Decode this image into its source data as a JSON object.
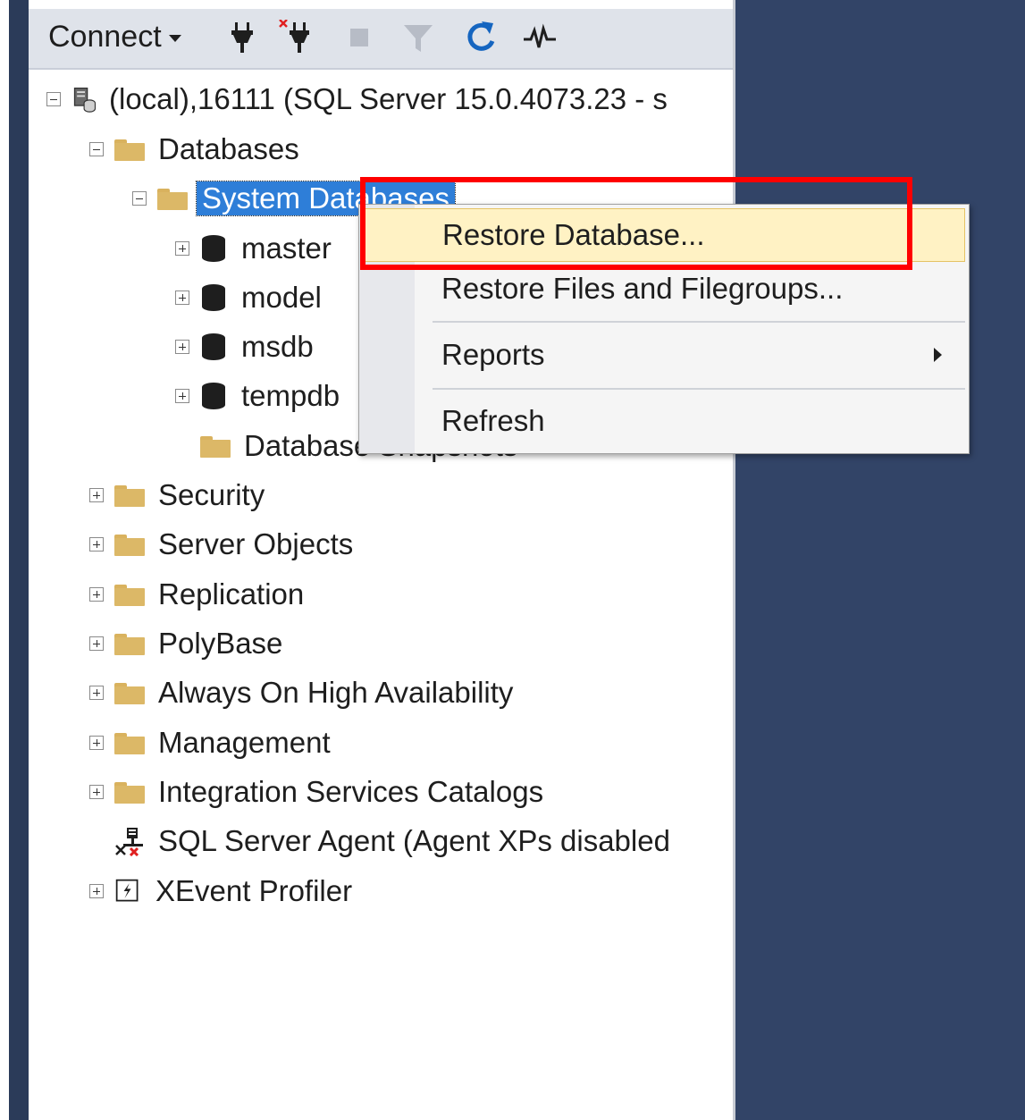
{
  "toolbar": {
    "connect_label": "Connect",
    "icons": [
      "connect-plug-icon",
      "disconnect-plug-icon",
      "stop-icon",
      "filter-icon",
      "refresh-icon",
      "activity-monitor-icon"
    ]
  },
  "tree": {
    "server": "(local),16111 (SQL Server 15.0.4073.23 - s",
    "databases": "Databases",
    "system_databases": "System Databases",
    "master": "master",
    "model": "model",
    "msdb": "msdb",
    "tempdb": "tempdb",
    "database_snapshots": "Database Snapshots",
    "security": "Security",
    "server_objects": "Server Objects",
    "replication": "Replication",
    "polybase": "PolyBase",
    "always_on": "Always On High Availability",
    "management": "Management",
    "integration_services": "Integration Services Catalogs",
    "sql_server_agent": "SQL Server Agent (Agent XPs disabled",
    "xevent_profiler": "XEvent Profiler"
  },
  "context_menu": {
    "restore_database": "Restore Database...",
    "restore_files": "Restore Files and Filegroups...",
    "reports": "Reports",
    "refresh": "Refresh"
  },
  "colors": {
    "selection": "#2e7ed8",
    "menu_hover": "#fff2c4",
    "annotation": "#ff0000",
    "frame": "#324467"
  }
}
